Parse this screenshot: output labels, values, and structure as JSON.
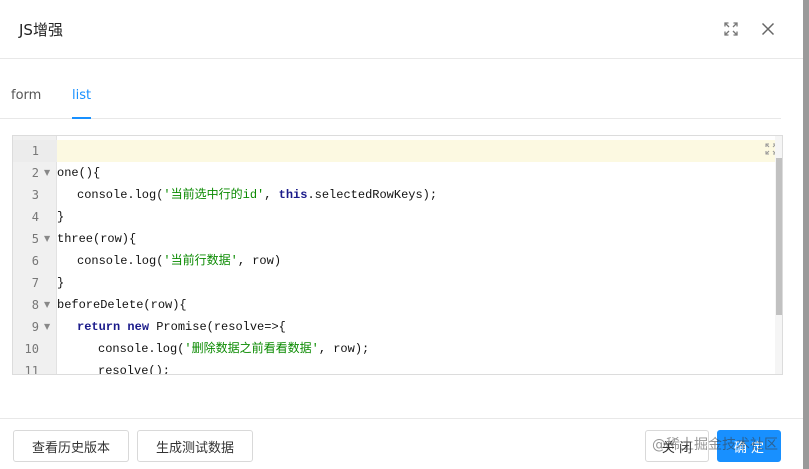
{
  "modal": {
    "title": "JS增强"
  },
  "tabs": [
    {
      "label": "form",
      "active": false
    },
    {
      "label": "list",
      "active": true
    }
  ],
  "editor": {
    "lines": [
      {
        "num": "1",
        "fold": false
      },
      {
        "num": "2",
        "fold": true
      },
      {
        "num": "3",
        "fold": false
      },
      {
        "num": "4",
        "fold": false
      },
      {
        "num": "5",
        "fold": true
      },
      {
        "num": "6",
        "fold": false
      },
      {
        "num": "7",
        "fold": false
      },
      {
        "num": "8",
        "fold": true
      },
      {
        "num": "9",
        "fold": true
      },
      {
        "num": "10",
        "fold": false
      },
      {
        "num": "11",
        "fold": false
      }
    ],
    "code": {
      "l2": "one(){",
      "l3_a": "console.log(",
      "l3_str": "'当前选中行的id'",
      "l3_b": ", ",
      "l3_kw": "this",
      "l3_c": ".selectedRowKeys);",
      "l4": "}",
      "l5": "three(row){",
      "l6_a": "console.log(",
      "l6_str": "'当前行数据'",
      "l6_b": ", row)",
      "l7": "}",
      "l8": "beforeDelete(row){",
      "l9_kw1": "return",
      "l9_kw2": "new",
      "l9_c": " Promise(resolve=>{",
      "l10_a": "console.log(",
      "l10_str": "'删除数据之前看看数据'",
      "l10_b": ", row);",
      "l11": "resolve();"
    }
  },
  "footer": {
    "history_label": "查看历史版本",
    "gen_test_label": "生成测试数据",
    "close_label": "关 闭",
    "confirm_label": "确 定",
    "watermark": "@稀土掘金技术社区"
  },
  "colors": {
    "primary": "#1890ff",
    "keyword": "#1a1a8a",
    "string": "#0a8a00",
    "active_line": "#fcf9e1"
  }
}
